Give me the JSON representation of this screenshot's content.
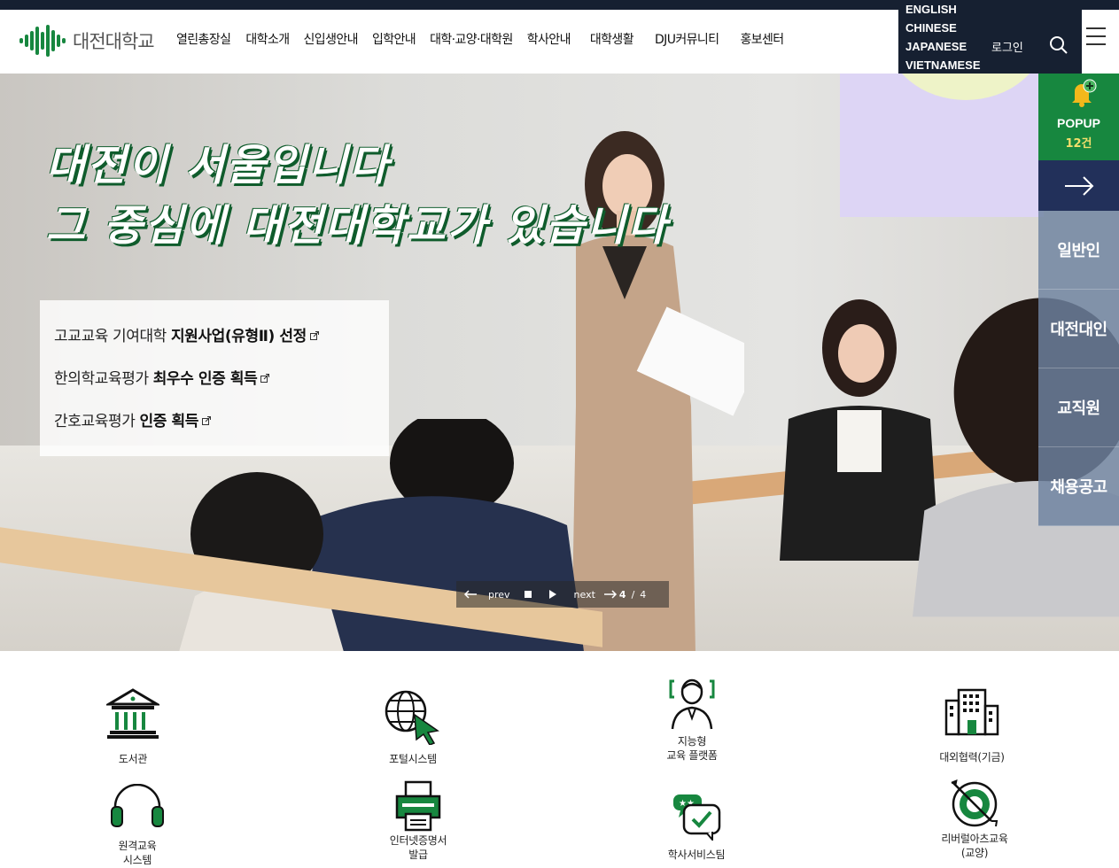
{
  "header": {
    "logo_text": "대전대학교",
    "menu": [
      "열린총장실",
      "대학소개",
      "신입생안내",
      "입학안내",
      "대학·교양·대학원",
      "학사안내",
      "대학생활",
      "DJU커뮤니티",
      "홍보센터"
    ],
    "languages": [
      "ENGLISH",
      "CHINESE",
      "JAPANESE",
      "VIETNAMESE"
    ],
    "login_label": "로그인"
  },
  "hero": {
    "headline_line1": "대전이 서울입니다",
    "headline_line2": "그 중심에 대전대학교가 있습니다",
    "news": [
      {
        "plain": "고교교육 기여대학 ",
        "bold": "지원사업(유형Ⅱ) 선정"
      },
      {
        "plain": "한의학교육평가 ",
        "bold": "최우수 인증 획득"
      },
      {
        "plain": "간호교육평가 ",
        "bold": "인증 획득"
      }
    ],
    "pager": {
      "prev": "prev",
      "next": "next",
      "current": "4",
      "separator": "/",
      "total": "4"
    }
  },
  "quick_menu": {
    "popup_label": "POPUP",
    "popup_count": "12건",
    "audiences": [
      "일반인",
      "대전대인",
      "교직원",
      "채용공고"
    ]
  },
  "services": [
    {
      "label": "도서관",
      "icon": "library-icon"
    },
    {
      "label": "포털시스템",
      "icon": "portal-icon"
    },
    {
      "label": "지능형\n교육 플랫폼",
      "icon": "smart-education-icon"
    },
    {
      "label": "대외협력(기금)",
      "icon": "building-icon"
    },
    {
      "label": "원격교육\n시스템",
      "icon": "headphones-icon"
    },
    {
      "label": "인터넷증명서\n발급",
      "icon": "printer-icon"
    },
    {
      "label": "학사서비스팀",
      "icon": "chat-check-icon"
    },
    {
      "label": "리버럴아츠교육\n(교양)",
      "icon": "target-icon"
    }
  ],
  "colors": {
    "brand_green": "#17873f",
    "navy": "#162031",
    "dark_blue": "#22305a"
  }
}
